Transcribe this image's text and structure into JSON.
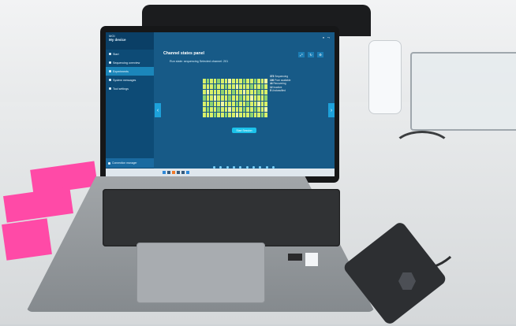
{
  "app": {
    "brand": "MGI",
    "device": "My device"
  },
  "sidebar": {
    "items": [
      {
        "label": "Start"
      },
      {
        "label": "Sequencing overview"
      },
      {
        "label": "Experiments"
      },
      {
        "label": "System messages"
      },
      {
        "label": "Tool settings"
      }
    ],
    "connection_label": "Connection manager"
  },
  "panel": {
    "title": "Channel states panel",
    "status": "Run state: sequencing    Selected channel: 201",
    "button": "Start Session"
  },
  "stats": [
    {
      "value": "373",
      "label": "Sequencing"
    },
    {
      "value": "100",
      "label": "Pore available"
    },
    {
      "value": "44",
      "label": "Recovering"
    },
    {
      "value": "12",
      "label": "Inactive"
    },
    {
      "value": "5",
      "label": "Unclassified"
    }
  ],
  "colors": {
    "screen_bg": "#175a87",
    "sidebar_bg": "#0d4b76",
    "accent": "#1da1da",
    "cell": "#d8f06a"
  }
}
